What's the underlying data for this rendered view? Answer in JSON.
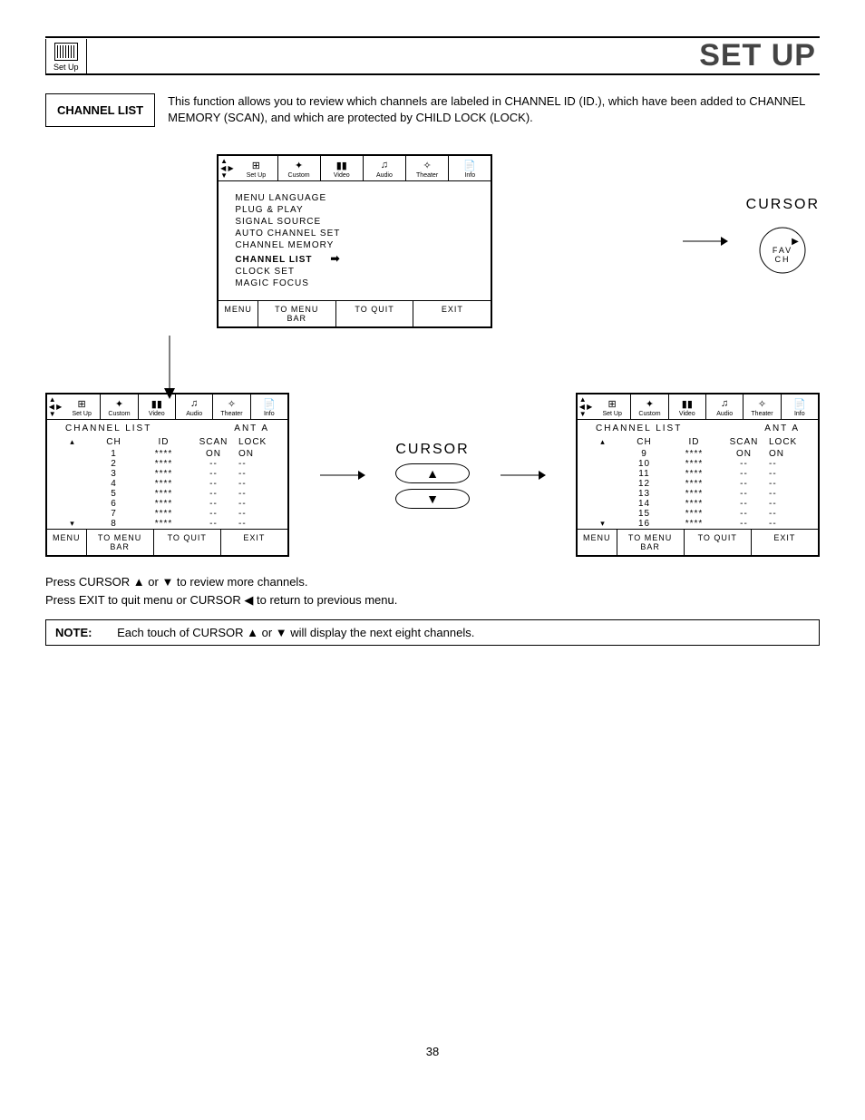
{
  "logo_label": "Set Up",
  "title": "SET UP",
  "section_label": "CHANNEL LIST",
  "intro": "This function allows you to review which channels are labeled in CHANNEL ID (ID.), which have been added to CHANNEL MEMORY (SCAN), and which are protected by CHILD LOCK (LOCK).",
  "menu_bar_tabs": [
    "Set Up",
    "Custom",
    "Video",
    "Audio",
    "Theater",
    "Info"
  ],
  "menu_items": [
    "MENU LANGUAGE",
    "PLUG & PLAY",
    "SIGNAL SOURCE",
    "AUTO CHANNEL SET",
    "CHANNEL MEMORY",
    "CHANNEL LIST",
    "CLOCK SET",
    "MAGIC FOCUS"
  ],
  "menu_selected_index": 5,
  "menu_footer": {
    "menu": "MENU",
    "bar": "TO MENU BAR",
    "quit": "TO QUIT",
    "exit": "EXIT"
  },
  "cursor_right": {
    "label": "CURSOR",
    "button": "FAV\nCH",
    "arrow": "▶"
  },
  "list_title": "CHANNEL LIST",
  "list_antenna": "ANT A",
  "list_columns": [
    "CH",
    "ID",
    "SCAN",
    "LOCK"
  ],
  "list1_rows": [
    {
      "ch": "1",
      "id": "****",
      "scan": "ON",
      "lock": "ON"
    },
    {
      "ch": "2",
      "id": "****",
      "scan": "--",
      "lock": "--"
    },
    {
      "ch": "3",
      "id": "****",
      "scan": "--",
      "lock": "--"
    },
    {
      "ch": "4",
      "id": "****",
      "scan": "--",
      "lock": "--"
    },
    {
      "ch": "5",
      "id": "****",
      "scan": "--",
      "lock": "--"
    },
    {
      "ch": "6",
      "id": "****",
      "scan": "--",
      "lock": "--"
    },
    {
      "ch": "7",
      "id": "****",
      "scan": "--",
      "lock": "--"
    },
    {
      "ch": "8",
      "id": "****",
      "scan": "--",
      "lock": "--"
    }
  ],
  "list2_rows": [
    {
      "ch": "9",
      "id": "****",
      "scan": "ON",
      "lock": "ON"
    },
    {
      "ch": "10",
      "id": "****",
      "scan": "--",
      "lock": "--"
    },
    {
      "ch": "11",
      "id": "****",
      "scan": "--",
      "lock": "--"
    },
    {
      "ch": "12",
      "id": "****",
      "scan": "--",
      "lock": "--"
    },
    {
      "ch": "13",
      "id": "****",
      "scan": "--",
      "lock": "--"
    },
    {
      "ch": "14",
      "id": "****",
      "scan": "--",
      "lock": "--"
    },
    {
      "ch": "15",
      "id": "****",
      "scan": "--",
      "lock": "--"
    },
    {
      "ch": "16",
      "id": "****",
      "scan": "--",
      "lock": "--"
    }
  ],
  "cursor_updown": {
    "label": "CURSOR",
    "up": "▲",
    "down": "▼"
  },
  "instr_line1": "Press CURSOR ▲ or ▼ to review more channels.",
  "instr_line2": "Press EXIT to quit menu or CURSOR ◀ to return to previous menu.",
  "note_label": "NOTE:",
  "note_text": "Each touch of CURSOR ▲ or ▼ will display the next eight channels.",
  "page_number": "38"
}
